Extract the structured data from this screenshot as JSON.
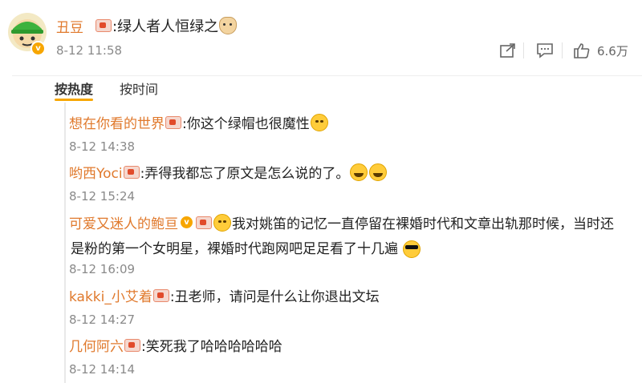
{
  "post": {
    "author": "丑豆",
    "text": ":绿人者人恒绿之",
    "time": "8-12 11:58",
    "like_count": "6.6万",
    "verified_icon": "v-badge-icon"
  },
  "sort": {
    "hot": "按热度",
    "time": "按时间"
  },
  "comments": [
    {
      "name": "想在你看的世界",
      "text": ":你这个绿帽也很魔性",
      "time": "8-12 14:38"
    },
    {
      "name": "哟西Yoci",
      "text": ":弄得我都忘了原文是怎么说的了。",
      "time": "8-12 15:24"
    },
    {
      "name": "可爱又迷人的鲍亘",
      "text": "我对姚笛的记忆一直停留在裸婚时代和文章出轨那时候，当时还",
      "text2": "是粉的第一个女明星，裸婚时代跑网吧足足看了十几遍",
      "time": "8-12 16:09"
    },
    {
      "name": "kakki_小艾着",
      "text": ":丑老师，请问是什么让你退出文坛",
      "time": "8-12 14:27"
    },
    {
      "name": "几何阿六",
      "text": ":笑死我了哈哈哈哈哈哈",
      "time": "8-12 14:14"
    }
  ],
  "colors": {
    "name": "#e0792c",
    "time": "#8a8a8a",
    "accent": "#f7a600"
  }
}
